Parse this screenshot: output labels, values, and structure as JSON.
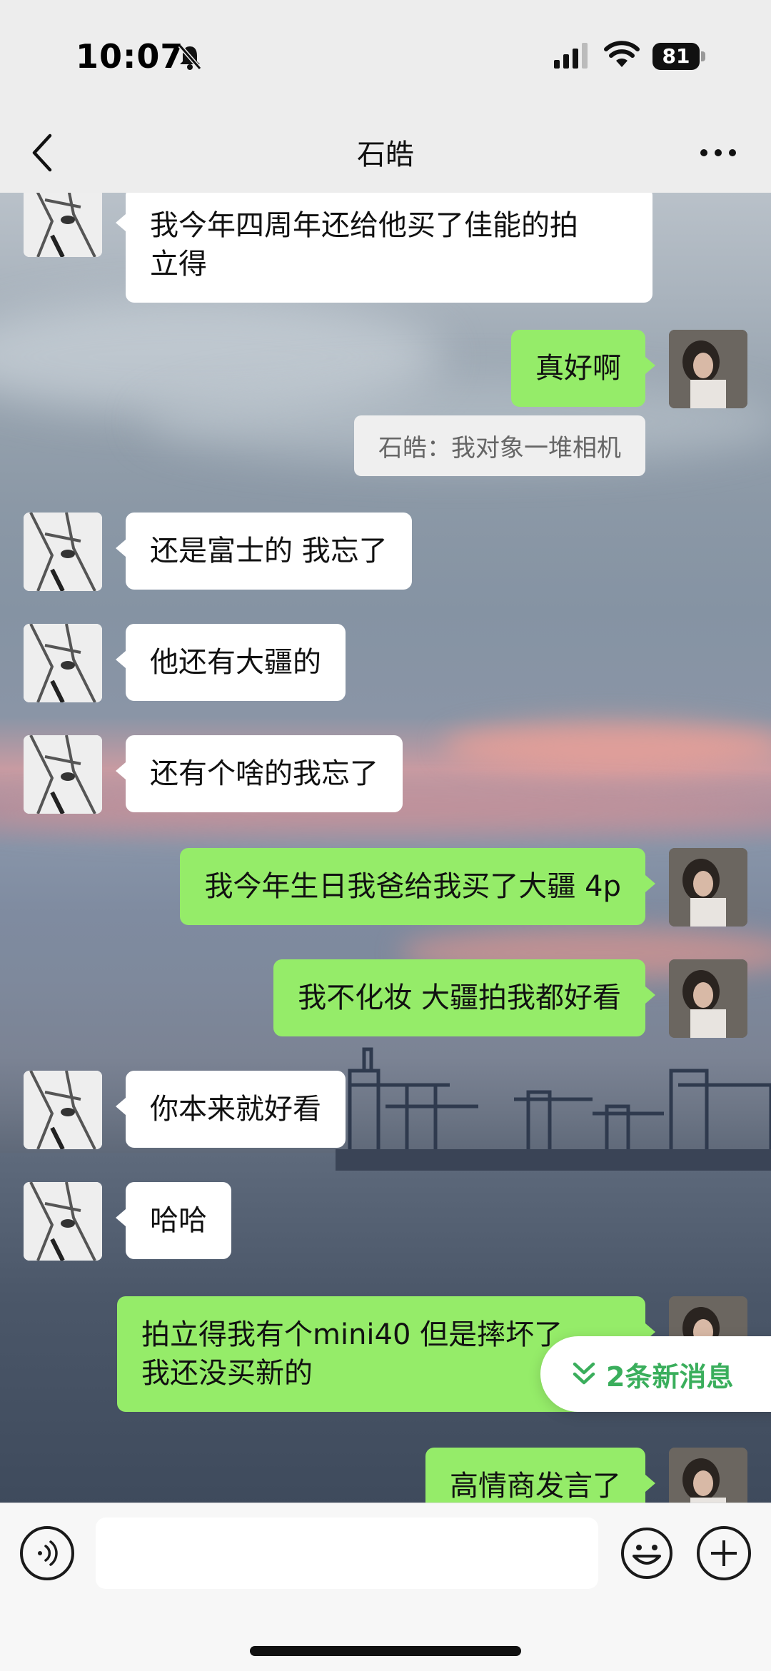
{
  "status_bar": {
    "time": "10:07",
    "battery": "81",
    "icons": [
      "bell-slash-icon",
      "signal-icon",
      "wifi-icon",
      "battery-icon"
    ]
  },
  "nav": {
    "title": "石皓",
    "back_icon": "chevron-left-icon",
    "more_icon": "more-dots-icon"
  },
  "messages": [
    {
      "side": "in",
      "text_lines": [
        "我今年四周年还给他买了佳能的拍",
        "立得"
      ]
    },
    {
      "side": "out",
      "text": "真好啊"
    },
    {
      "side": "quote",
      "text": "石皓：我对象一堆相机"
    },
    {
      "side": "in",
      "text": "还是富士的 我忘了"
    },
    {
      "side": "in",
      "text": "他还有大疆的"
    },
    {
      "side": "in",
      "text": "还有个啥的我忘了"
    },
    {
      "side": "out",
      "text": "我今年生日我爸给我买了大疆 4p"
    },
    {
      "side": "out",
      "text": "我不化妆 大疆拍我都好看"
    },
    {
      "side": "in",
      "text": "你本来就好看"
    },
    {
      "side": "in",
      "text": "哈哈"
    },
    {
      "side": "out",
      "text_lines": [
        "拍立得我有个mini40  但是摔坏了",
        "我还没买新的"
      ]
    },
    {
      "side": "out",
      "text": "高情商发言了"
    }
  ],
  "new_messages": {
    "label": "2条新消息",
    "icon": "double-chevron-down-icon"
  },
  "input_bar": {
    "voice_icon": "voice-icon",
    "text_value": "",
    "emoji_icon": "emoji-icon",
    "plus_icon": "plus-icon"
  },
  "colors": {
    "outgoing_bubble": "#95ec69",
    "incoming_bubble": "#ffffff",
    "accent_green": "#3aae5c",
    "bar_background": "#ededed"
  }
}
